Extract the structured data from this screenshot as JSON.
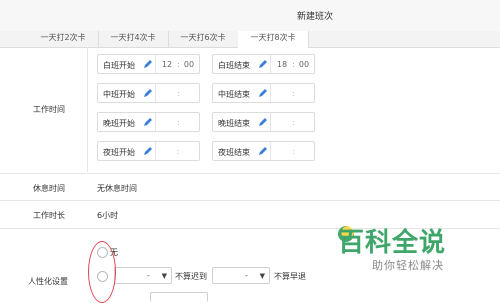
{
  "header": {
    "title": "新建班次"
  },
  "tabs": [
    {
      "label": "一天打2次卡"
    },
    {
      "label": "一天打4次卡"
    },
    {
      "label": "一天打6次卡"
    },
    {
      "label": "一天打8次卡"
    }
  ],
  "work_time": {
    "label": "工作时间",
    "slots": [
      {
        "label": "白班开始",
        "hour": "12",
        "minute": "00"
      },
      {
        "label": "白班结束",
        "hour": "18",
        "minute": "00"
      },
      {
        "label": "中班开始",
        "hour": "",
        "minute": ""
      },
      {
        "label": "中班结束",
        "hour": "",
        "minute": ""
      },
      {
        "label": "晚班开始",
        "hour": "",
        "minute": ""
      },
      {
        "label": "晚班结束",
        "hour": "",
        "minute": ""
      },
      {
        "label": "夜班开始",
        "hour": "",
        "minute": ""
      },
      {
        "label": "夜班结束",
        "hour": "",
        "minute": ""
      }
    ]
  },
  "rest_time": {
    "label": "休息时间",
    "value": "无休息时间"
  },
  "work_duration": {
    "label": "工作时长",
    "value": "6小时"
  },
  "humanize": {
    "label": "人性化设置",
    "option_none": "无",
    "late_select": "-",
    "late_text": "不算迟到",
    "early_select": "-",
    "early_text": "不算早退"
  },
  "watermark": {
    "main": "百科全说",
    "sub": "助你轻松解决"
  },
  "colors": {
    "highlight": "#e0474f",
    "watermark": "#3fa66a",
    "pen_icon": "#3b7fd9"
  }
}
